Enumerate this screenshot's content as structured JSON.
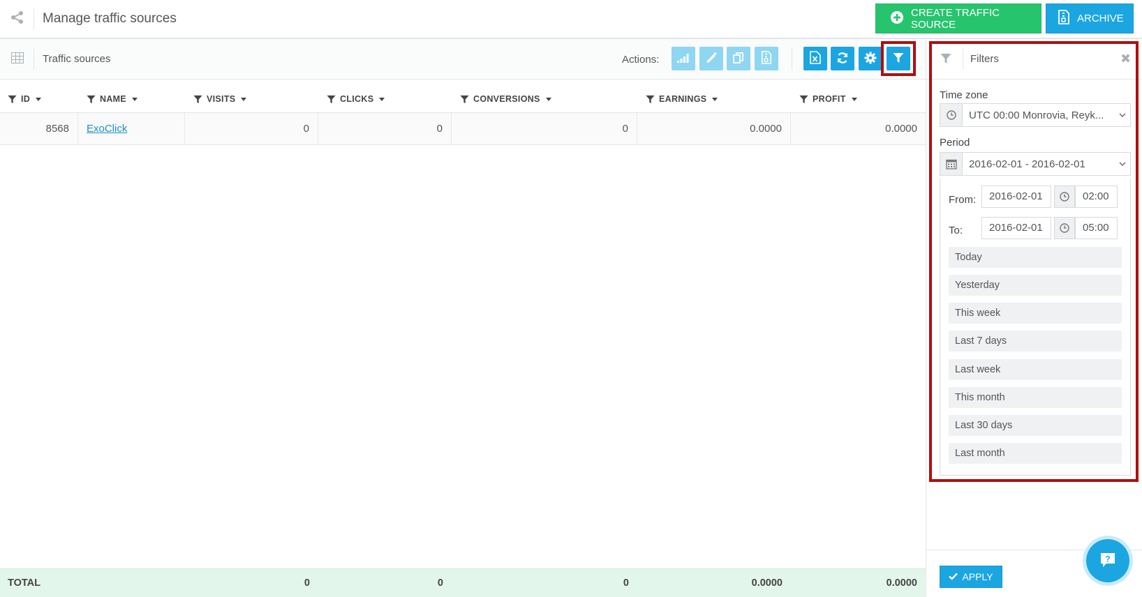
{
  "header": {
    "title": "Manage traffic sources",
    "create_label": "CREATE TRAFFIC SOURCE",
    "archive_label": "ARCHIVE"
  },
  "toolbar": {
    "title": "Traffic sources",
    "actions_label": "Actions:"
  },
  "table": {
    "columns": [
      "ID",
      "NAME",
      "VISITS",
      "CLICKS",
      "CONVERSIONS",
      "EARNINGS",
      "PROFIT"
    ],
    "rows": [
      {
        "id": "8568",
        "name": "ExoClick",
        "visits": "0",
        "clicks": "0",
        "conversions": "0",
        "earnings": "0.0000",
        "profit": "0.0000"
      }
    ],
    "total": {
      "label": "TOTAL",
      "visits": "0",
      "clicks": "0",
      "conversions": "0",
      "earnings": "0.0000",
      "profit": "0.0000"
    }
  },
  "filters": {
    "title": "Filters",
    "timezone_label": "Time zone",
    "timezone_value": "UTC 00:00 Monrovia, Reyk...",
    "period_label": "Period",
    "period_value": "2016-02-01 - 2016-02-01",
    "from_label": "From:",
    "from_date": "2016-02-01",
    "from_time": "02:00",
    "to_label": "To:",
    "to_date": "2016-02-01",
    "to_time": "05:00",
    "presets": [
      "Today",
      "Yesterday",
      "This week",
      "Last 7 days",
      "Last week",
      "This month",
      "Last 30 days",
      "Last month"
    ],
    "apply_label": "APPLY"
  },
  "colors": {
    "accent": "#1ba6e2",
    "create_green": "#27c46e",
    "highlight": "#b20d0d",
    "total_bg": "#e3f6ec"
  }
}
